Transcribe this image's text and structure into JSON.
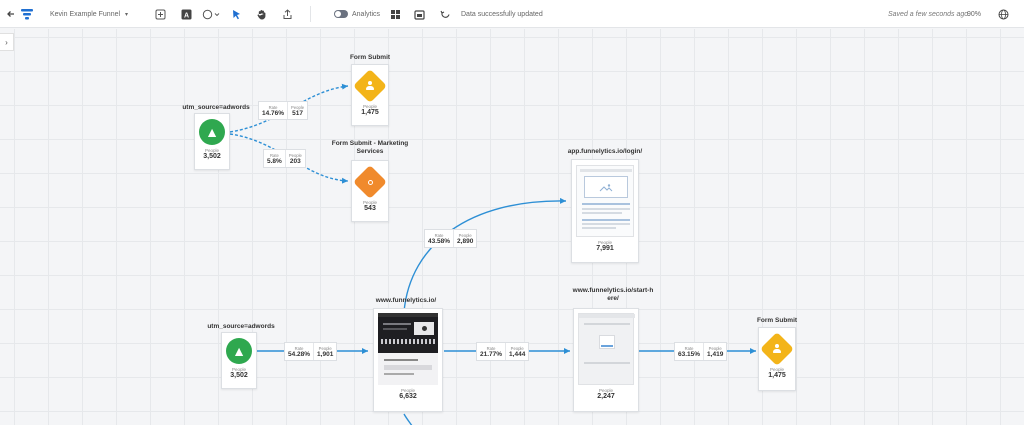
{
  "toolbar": {
    "funnel_name": "Kevin Example Funnel",
    "analytics_label": "Analytics",
    "status_message": "Data successfully updated",
    "saved_text": "Saved a few seconds ago",
    "zoom": "90%"
  },
  "nodes": {
    "src_top": {
      "label": "utm_source=adwords",
      "people_label": "People",
      "people": "3,502"
    },
    "form_submit_top": {
      "label": "Form Submit",
      "people_label": "People",
      "people": "1,475"
    },
    "form_submit_marketing": {
      "label_line1": "Form Submit - Marketing",
      "label_line2": "Services",
      "people_label": "People",
      "people": "543"
    },
    "login_page": {
      "label": "app.funnelytics.io/login/",
      "people_label": "People",
      "people": "7,991"
    },
    "src_bottom": {
      "label": "utm_source=adwords",
      "people_label": "People",
      "people": "3,502"
    },
    "home_page": {
      "label": "www.funnelytics.io/",
      "people_label": "People",
      "people": "6,632"
    },
    "start_here": {
      "label_line1": "www.funnelytics.io/start-h",
      "label_line2": "ere/",
      "people_label": "People",
      "people": "2,247"
    },
    "form_submit_bottom": {
      "label": "Form Submit",
      "people_label": "People",
      "people": "1,475"
    }
  },
  "stats": {
    "s1": {
      "rate_label": "Rate",
      "rate": "14.76%",
      "people_label": "People",
      "people": "517"
    },
    "s2": {
      "rate_label": "Rate",
      "rate": "5.8%",
      "people_label": "People",
      "people": "203"
    },
    "s3": {
      "rate_label": "Rate",
      "rate": "43.58%",
      "people_label": "People",
      "people": "2,890"
    },
    "s4": {
      "rate_label": "Rate",
      "rate": "54.28%",
      "people_label": "People",
      "people": "1,901"
    },
    "s5": {
      "rate_label": "Rate",
      "rate": "21.77%",
      "people_label": "People",
      "people": "1,444"
    },
    "s6": {
      "rate_label": "Rate",
      "rate": "63.15%",
      "people_label": "People",
      "people": "1,419"
    }
  },
  "colors": {
    "edge": "#2d8fd5",
    "source_green": "#2fa84f",
    "goal_yellow": "#f3b419",
    "goal_orange": "#f08a2c",
    "brand_blue": "#1f6fd1"
  }
}
